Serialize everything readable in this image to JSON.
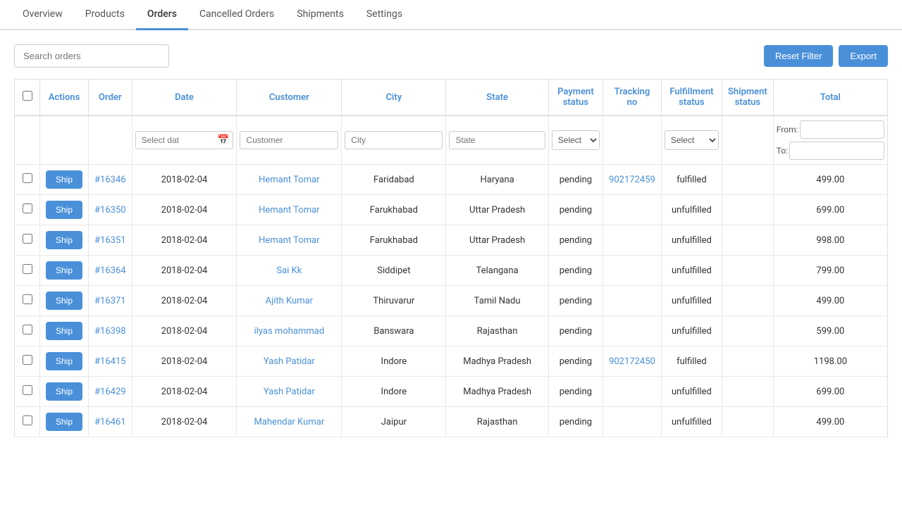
{
  "tabs": [
    {
      "label": "Overview",
      "active": false
    },
    {
      "label": "Products",
      "active": false
    },
    {
      "label": "Orders",
      "active": true
    },
    {
      "label": "Cancelled Orders",
      "active": false
    },
    {
      "label": "Shipments",
      "active": false
    },
    {
      "label": "Settings",
      "active": false
    }
  ],
  "toolbar": {
    "search_placeholder": "Search orders",
    "reset_filter_label": "Reset Filter",
    "export_label": "Export"
  },
  "table": {
    "columns": [
      "Actions",
      "Order",
      "Date",
      "Customer",
      "City",
      "State",
      "Payment status",
      "Tracking no",
      "Fulfillment status",
      "Shipment status",
      "Total"
    ],
    "filters": {
      "date_placeholder": "Select dat",
      "customer_placeholder": "Customer",
      "city_placeholder": "City",
      "state_placeholder": "State",
      "payment_placeholder": "Select",
      "fulfillment_placeholder": "Select",
      "total_from_label": "From:",
      "total_to_label": "To:"
    },
    "rows": [
      {
        "id": "#16346",
        "date": "2018-02-04",
        "customer": "Hemant Tomar",
        "city": "Faridabad",
        "state": "Haryana",
        "payment": "pending",
        "tracking": "902172459",
        "fulfillment": "fulfilled",
        "shipment": "",
        "total": "499.00"
      },
      {
        "id": "#16350",
        "date": "2018-02-04",
        "customer": "Hemant Tomar",
        "city": "Farukhabad",
        "state": "Uttar Pradesh",
        "payment": "pending",
        "tracking": "",
        "fulfillment": "unfulfilled",
        "shipment": "",
        "total": "699.00"
      },
      {
        "id": "#16351",
        "date": "2018-02-04",
        "customer": "Hemant Tomar",
        "city": "Farukhabad",
        "state": "Uttar Pradesh",
        "payment": "pending",
        "tracking": "",
        "fulfillment": "unfulfilled",
        "shipment": "",
        "total": "998.00"
      },
      {
        "id": "#16364",
        "date": "2018-02-04",
        "customer": "Sai Kk",
        "city": "Siddipet",
        "state": "Telangana",
        "payment": "pending",
        "tracking": "",
        "fulfillment": "unfulfilled",
        "shipment": "",
        "total": "799.00"
      },
      {
        "id": "#16371",
        "date": "2018-02-04",
        "customer": "Ajith Kumar",
        "city": "Thiruvarur",
        "state": "Tamil Nadu",
        "payment": "pending",
        "tracking": "",
        "fulfillment": "unfulfilled",
        "shipment": "",
        "total": "499.00"
      },
      {
        "id": "#16398",
        "date": "2018-02-04",
        "customer": "ilyas mohammad",
        "city": "Banswara",
        "state": "Rajasthan",
        "payment": "pending",
        "tracking": "",
        "fulfillment": "unfulfilled",
        "shipment": "",
        "total": "599.00"
      },
      {
        "id": "#16415",
        "date": "2018-02-04",
        "customer": "Yash Patidar",
        "city": "Indore",
        "state": "Madhya Pradesh",
        "payment": "pending",
        "tracking": "902172450",
        "fulfillment": "fulfilled",
        "shipment": "",
        "total": "1198.00"
      },
      {
        "id": "#16429",
        "date": "2018-02-04",
        "customer": "Yash Patidar",
        "city": "Indore",
        "state": "Madhya Pradesh",
        "payment": "pending",
        "tracking": "",
        "fulfillment": "unfulfilled",
        "shipment": "",
        "total": "699.00"
      },
      {
        "id": "#16461",
        "date": "2018-02-04",
        "customer": "Mahendar Kumar",
        "city": "Jaipur",
        "state": "Rajasthan",
        "payment": "pending",
        "tracking": "",
        "fulfillment": "unfulfilled",
        "shipment": "",
        "total": "499.00"
      }
    ],
    "ship_label": "Ship"
  }
}
